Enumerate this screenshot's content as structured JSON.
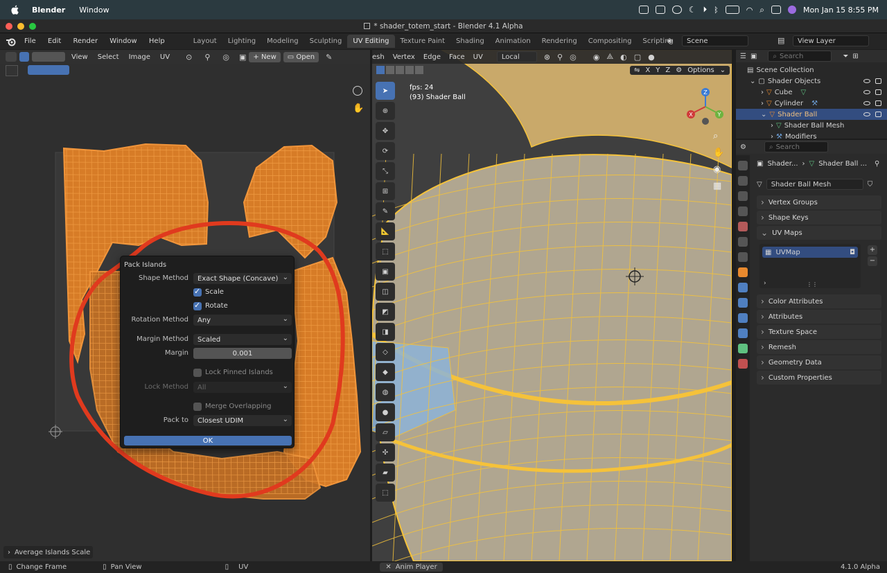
{
  "macos": {
    "app_name": "Blender",
    "menu_window": "Window",
    "clock": "Mon Jan 15  8:55 PM"
  },
  "window": {
    "title": "* shader_totem_start - Blender 4.1 Alpha"
  },
  "topbar": {
    "menus": [
      "File",
      "Edit",
      "Render",
      "Window",
      "Help"
    ],
    "workspaces": [
      "Layout",
      "Lighting",
      "Modeling",
      "Sculpting",
      "UV Editing",
      "Texture Paint",
      "Shading",
      "Animation",
      "Rendering",
      "Compositing",
      "Scripting"
    ],
    "active_workspace": "UV Editing",
    "scene": "Scene",
    "view_layer": "View Layer"
  },
  "uv_editor": {
    "menus": [
      "View",
      "Select",
      "Image",
      "UV"
    ],
    "new_label": "New",
    "open_label": "Open",
    "redo_panel": "Average Islands Scale"
  },
  "pack_dialog": {
    "title": "Pack Islands",
    "shape_method_label": "Shape Method",
    "shape_method_value": "Exact Shape (Concave)",
    "scale_label": "Scale",
    "scale_checked": true,
    "rotate_label": "Rotate",
    "rotate_checked": true,
    "rotation_method_label": "Rotation Method",
    "rotation_method_value": "Any",
    "margin_method_label": "Margin Method",
    "margin_method_value": "Scaled",
    "margin_label": "Margin",
    "margin_value": "0.001",
    "lock_pinned_label": "Lock Pinned Islands",
    "lock_pinned_checked": false,
    "lock_method_label": "Lock Method",
    "lock_method_value": "All",
    "merge_overlapping_label": "Merge Overlapping",
    "merge_overlapping_checked": false,
    "pack_to_label": "Pack to",
    "pack_to_value": "Closest UDIM",
    "ok_label": "OK"
  },
  "viewport": {
    "menus": [
      "esh",
      "Vertex",
      "Edge",
      "Face",
      "UV"
    ],
    "orientation": "Local",
    "fps": "fps: 24",
    "object_info": "(93) Shader Ball",
    "options": "Options",
    "axes": [
      "X",
      "Y",
      "Z"
    ],
    "gizmo_axes": [
      "X",
      "Y",
      "Z"
    ]
  },
  "outliner": {
    "search_placeholder": "Search",
    "rows": [
      {
        "label": "Scene Collection",
        "indent": 0
      },
      {
        "label": "Shader Objects",
        "indent": 1
      },
      {
        "label": "Cube",
        "indent": 2
      },
      {
        "label": "Cylinder",
        "indent": 2
      },
      {
        "label": "Shader Ball",
        "indent": 2
      },
      {
        "label": "Shader Ball Mesh",
        "indent": 3
      },
      {
        "label": "Modifiers",
        "indent": 3
      }
    ]
  },
  "properties": {
    "search_placeholder": "Search",
    "breadcrumb_1": "Shader...",
    "breadcrumb_2": "Shader Ball ...",
    "mesh_name": "Shader Ball Mesh",
    "uv_map_name": "UVMap",
    "sections": [
      "Vertex Groups",
      "Shape Keys",
      "UV Maps",
      "Color Attributes",
      "Attributes",
      "Texture Space",
      "Remesh",
      "Geometry Data",
      "Custom Properties"
    ]
  },
  "statusbar": {
    "left": "Change Frame",
    "mid": "Pan View",
    "uv": "UV",
    "anim": "Anim Player",
    "version": "4.1.0 Alpha"
  },
  "colors": {
    "uv_mesh": "#e8892e",
    "selection": "#4772b3",
    "annotation": "#e03a1e",
    "wire": "#f5c23a"
  }
}
